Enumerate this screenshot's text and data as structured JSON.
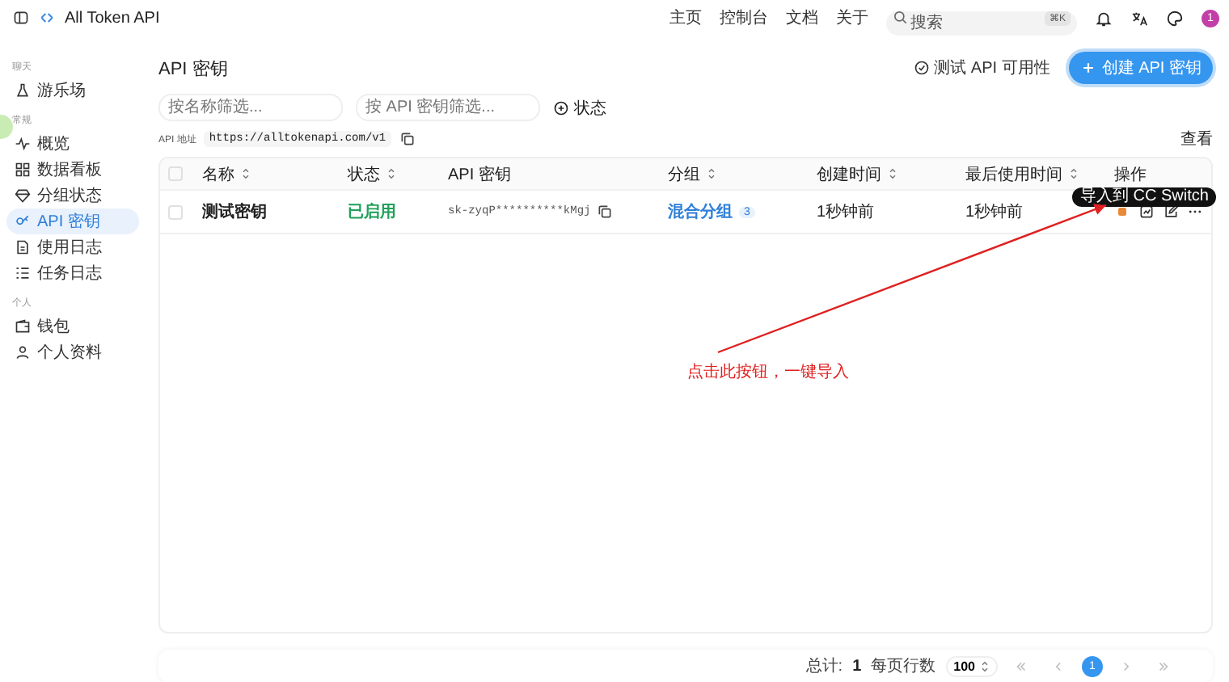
{
  "brand": {
    "name": "All Token API"
  },
  "nav": [
    "主页",
    "控制台",
    "文档",
    "关于"
  ],
  "search": {
    "placeholder": "搜索",
    "shortcut": "⌘K"
  },
  "avatar": "1",
  "sidebar": {
    "sections": [
      {
        "title": "聊天",
        "items": [
          {
            "label": "游乐场",
            "selected": false
          }
        ]
      },
      {
        "title": "常规",
        "items": [
          {
            "label": "概览",
            "selected": false
          },
          {
            "label": "数据看板",
            "selected": false
          },
          {
            "label": "分组状态",
            "selected": false
          },
          {
            "label": "API 密钥",
            "selected": true
          },
          {
            "label": "使用日志",
            "selected": false
          },
          {
            "label": "任务日志",
            "selected": false
          }
        ]
      },
      {
        "title": "个人",
        "items": [
          {
            "label": "钱包",
            "selected": false
          },
          {
            "label": "个人资料",
            "selected": false
          }
        ]
      }
    ]
  },
  "page": {
    "title": "API 密钥",
    "test_button": "测试 API 可用性",
    "create_button": "创建 API 密钥",
    "filters": [
      {
        "placeholder": "按名称筛选..."
      },
      {
        "placeholder": "按 API 密钥筛选..."
      }
    ],
    "status_filter": "状态",
    "api_address_label": "API 地址",
    "api_address": "https://alltokenapi.com/v1",
    "view_button": "查看"
  },
  "table": {
    "select_all_checked": false,
    "columns": [
      {
        "label": "名称",
        "sortable": true
      },
      {
        "label": "状态",
        "sortable": true
      },
      {
        "label": "API 密钥",
        "sortable": false
      },
      {
        "label": "分组",
        "sortable": true
      },
      {
        "label": "创建时间",
        "sortable": true
      },
      {
        "label": "最后使用时间",
        "sortable": true
      },
      {
        "label": "操作",
        "sortable": false
      }
    ],
    "rows": [
      {
        "checked": false,
        "name": "测试密钥",
        "status": "已启用",
        "key": "sk-zyqP**********kMgj",
        "group": "混合分组",
        "group_count": "3",
        "created": "1秒钟前",
        "last_used": "1秒钟前"
      }
    ]
  },
  "tooltip": "导入到 CC Switch",
  "annotation": "点击此按钮，一键导入",
  "pagination": {
    "total_label": "总计:",
    "total": "1",
    "per_page_label": "每页行数",
    "per_page": "100",
    "pages": [
      {
        "label": "1",
        "selected": true
      }
    ]
  }
}
